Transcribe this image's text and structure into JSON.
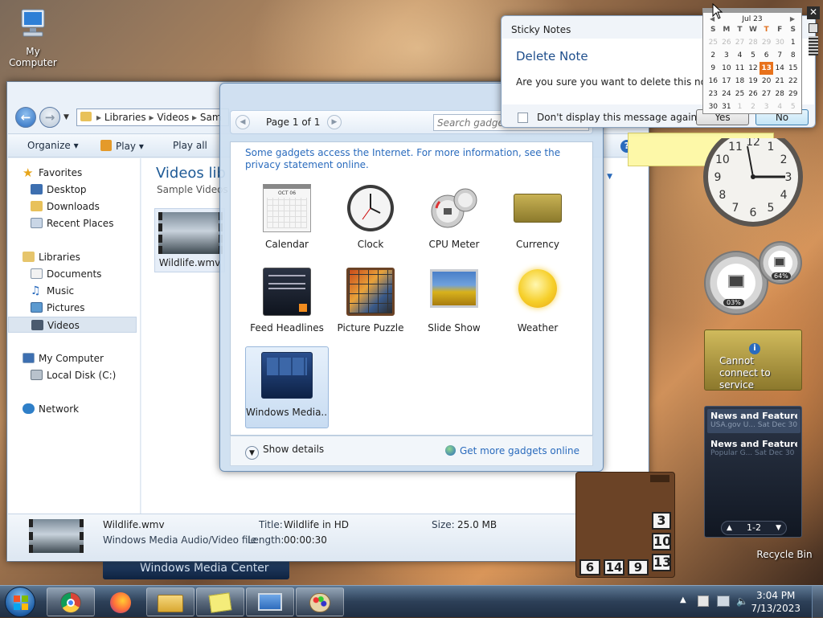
{
  "desktop": {
    "my_computer": "My Computer",
    "recycle_bin": "Recycle Bin",
    "wmc_banner": "Windows Media Center"
  },
  "explorer": {
    "address": [
      "Libraries",
      "Videos",
      "Sam"
    ],
    "toolbar": {
      "organize": "Organize",
      "play": "Play",
      "play_all": "Play all"
    },
    "nav": {
      "favorites": "Favorites",
      "desktop": "Desktop",
      "downloads": "Downloads",
      "recent": "Recent Places",
      "libraries": "Libraries",
      "documents": "Documents",
      "music": "Music",
      "pictures": "Pictures",
      "videos": "Videos",
      "computer": "My Computer",
      "local_disk": "Local Disk (C:)",
      "network": "Network"
    },
    "main": {
      "title": "Videos lib",
      "subtitle": "Sample Videos",
      "file": "Wildlife.wmv"
    },
    "status": {
      "filename": "Wildlife.wmv",
      "filetype": "Windows Media Audio/Video file",
      "title_label": "Title:",
      "title_value": "Wildlife in HD",
      "length_label": "Length:",
      "length_value": "00:00:30",
      "size_label": "Size:",
      "size_value": "25.0 MB"
    }
  },
  "gallery": {
    "page": "Page 1 of 1",
    "search_placeholder": "Search gadgets",
    "notice": "Some gadgets access the Internet.  For more information, see the privacy statement online.",
    "items": [
      "Calendar",
      "Clock",
      "CPU Meter",
      "Currency",
      "Feed Headlines",
      "Picture Puzzle",
      "Slide Show",
      "Weather",
      "Windows Media..."
    ],
    "calendar_month": "OCT 06",
    "show_details": "Show details",
    "get_more": "Get more gadgets online"
  },
  "dialog": {
    "app": "Sticky Notes",
    "heading": "Delete Note",
    "message": "Are you sure you want to delete this note?",
    "checkbox": "Don't display this message again",
    "yes": "Yes",
    "no": "No"
  },
  "calendar": {
    "month": "Jul 23",
    "days": [
      "S",
      "M",
      "T",
      "W",
      "T",
      "F",
      "S"
    ],
    "weeks": [
      [
        "25",
        "26",
        "27",
        "28",
        "29",
        "30",
        "1"
      ],
      [
        "2",
        "3",
        "4",
        "5",
        "6",
        "7",
        "8"
      ],
      [
        "9",
        "10",
        "11",
        "12",
        "13",
        "14",
        "15"
      ],
      [
        "16",
        "17",
        "18",
        "19",
        "20",
        "21",
        "22"
      ],
      [
        "23",
        "24",
        "25",
        "26",
        "27",
        "28",
        "29"
      ],
      [
        "30",
        "31",
        "1",
        "2",
        "3",
        "4",
        "5"
      ]
    ],
    "today": "13"
  },
  "clock": {
    "numbers": [
      "12",
      "1",
      "2",
      "3",
      "4",
      "5",
      "6",
      "7",
      "8",
      "9",
      "10",
      "11"
    ]
  },
  "cpu": {
    "cpu": "03%",
    "mem": "64%"
  },
  "currency": {
    "message": "Cannot connect to service"
  },
  "feeds": {
    "items": [
      {
        "title": "News and Features f...",
        "source": "USA.gov U...",
        "date": "Sat Dec 30"
      },
      {
        "title": "News and Features f...",
        "source": "Popular G...",
        "date": "Sat Dec 30"
      }
    ],
    "pager": "1-2"
  },
  "puzzle": {
    "tiles": [
      "3",
      "10",
      "13",
      "6",
      "14",
      "9"
    ]
  },
  "taskbar": {
    "time": "3:04 PM",
    "date": "7/13/2023"
  }
}
